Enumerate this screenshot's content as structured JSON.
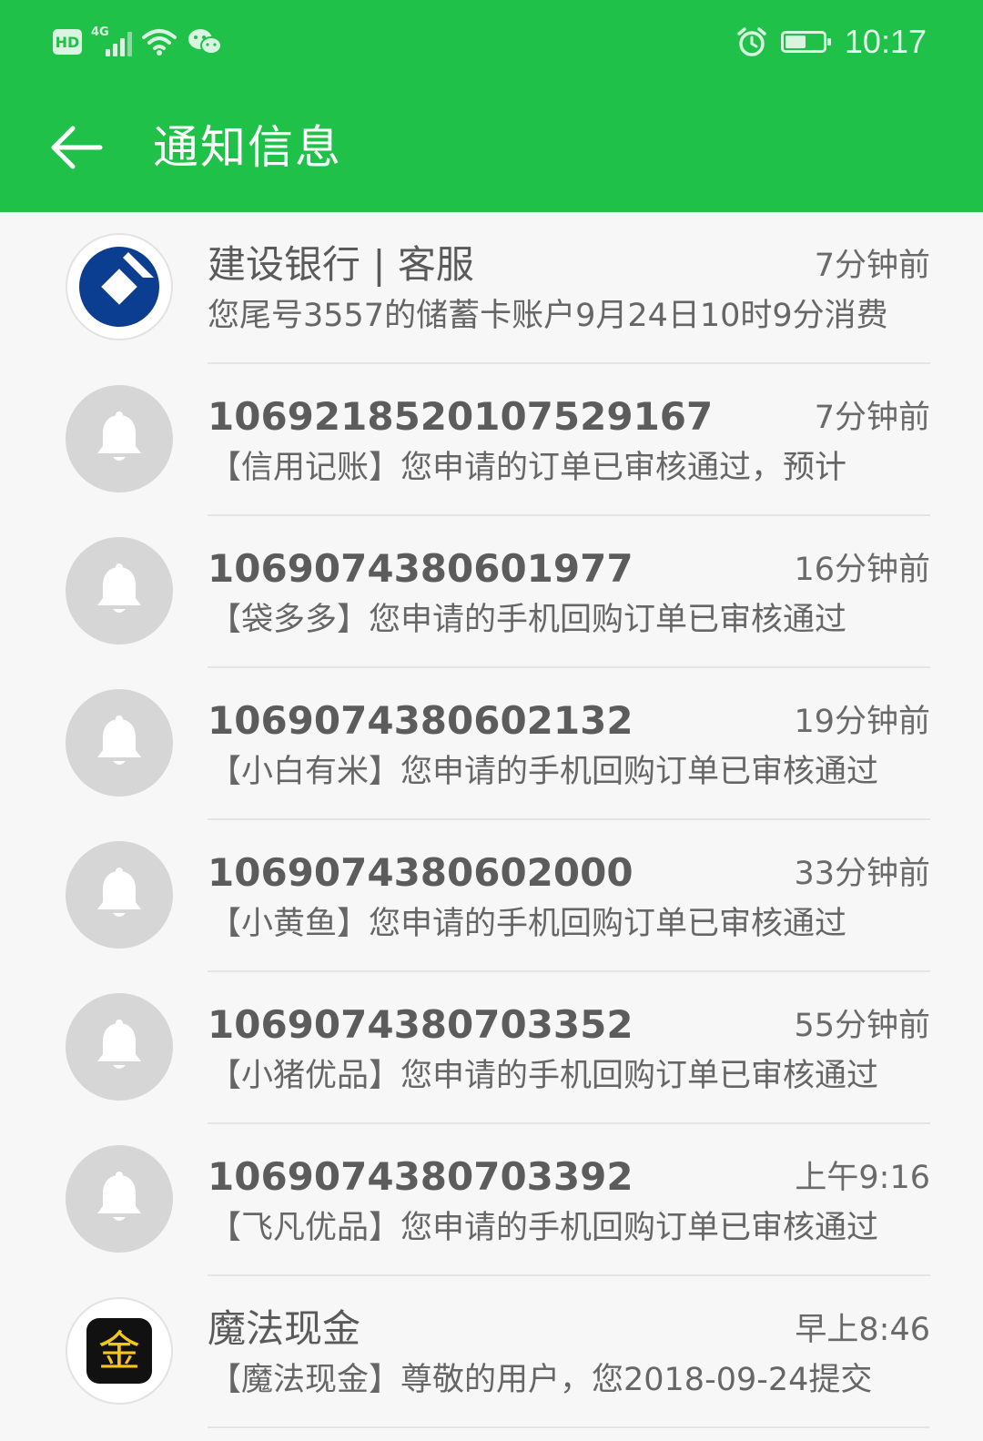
{
  "status_bar": {
    "hd": "HD",
    "network": "4G",
    "time": "10:17",
    "battery_level": 0.55
  },
  "header": {
    "title": "通知信息",
    "color": "#20c149"
  },
  "messages": [
    {
      "sender": "建设银行 | 客服",
      "time": "7分钟前",
      "preview": "您尾号3557的储蓄卡账户9月24日10时9分消费",
      "avatar": "ccb-logo-icon"
    },
    {
      "sender": "1069218520107529167",
      "time": "7分钟前",
      "preview": "【信用记账】您申请的订单已审核通过，预计",
      "avatar": "bell-icon"
    },
    {
      "sender": "1069074380601977",
      "time": "16分钟前",
      "preview": "【袋多多】您申请的手机回购订单已审核通过",
      "avatar": "bell-icon"
    },
    {
      "sender": "1069074380602132",
      "time": "19分钟前",
      "preview": "【小白有米】您申请的手机回购订单已审核通过",
      "avatar": "bell-icon"
    },
    {
      "sender": "1069074380602000",
      "time": "33分钟前",
      "preview": "【小黄鱼】您申请的手机回购订单已审核通过",
      "avatar": "bell-icon"
    },
    {
      "sender": "1069074380703352",
      "time": "55分钟前",
      "preview": "【小猪优品】您申请的手机回购订单已审核通过",
      "avatar": "bell-icon"
    },
    {
      "sender": "1069074380703392",
      "time": "上午9:16",
      "preview": "【飞凡优品】您申请的手机回购订单已审核通过",
      "avatar": "bell-icon"
    },
    {
      "sender": "魔法现金",
      "time": "早上8:46",
      "preview": "【魔法现金】尊敬的用户，您2018-09-24提交",
      "avatar": "mofa-logo-icon",
      "logo_char": "金"
    }
  ]
}
